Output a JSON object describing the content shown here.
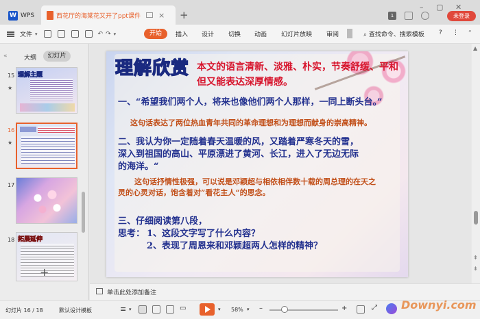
{
  "titlebar": {
    "app_tab": "WPS",
    "doc_tab": "西花厅的海棠花又开了ppt课件",
    "login": "未登录",
    "badge": "1"
  },
  "menubar": {
    "file": "文件",
    "items": [
      "开始",
      "插入",
      "设计",
      "切换",
      "动画",
      "幻灯片放映",
      "审阅"
    ],
    "search": "查找命令、搜索模板"
  },
  "leftpanel": {
    "tab_outline": "大纲",
    "tab_slides": "幻灯片",
    "slides": [
      {
        "num": "15",
        "label": "理解主题"
      },
      {
        "num": "16",
        "label": ""
      },
      {
        "num": "17",
        "label": ""
      },
      {
        "num": "18",
        "label": "拓展延伸"
      }
    ]
  },
  "slide": {
    "title": "理解欣赏",
    "intro": "本文的语言清新、淡雅、朴实，节奏舒缓、平和但又能表达深厚情感。",
    "p1": "一、“希望我们两个人，将来也像他们两个人那样，一同上断头台。”",
    "p1_note": "这句话表达了两位热血青年共同的革命理想和为理想而献身的崇高精神。",
    "p2_line1": "二、我认为你一定随着春天温暖的风，又踏着严寒冬天的雪，",
    "p2_line2": "深入到祖国的高山、平原漂进了黄河、长江，进入了无边无际",
    "p2_line3": "的海洋。“",
    "p2_note_line1": "这句话抒情性极强，可以说是邓颖超与相依相伴数十载的周总理的在天之",
    "p2_note_line2": "灵的心灵对话，饱含着对”看花主人“的思念。",
    "p3": "三、仔细阅读第八段，",
    "q_label": "思考：",
    "q1": "1、这段文字写了什么内容？",
    "q2": "2、表现了周恩来和邓颖超两人怎样的精神？"
  },
  "notes": {
    "placeholder": "单击此处添加备注"
  },
  "status": {
    "slide_count": "幻灯片 16 / 18",
    "template": "默认设计模板",
    "zoom": "58%",
    "watermark": "Downyi.com"
  }
}
